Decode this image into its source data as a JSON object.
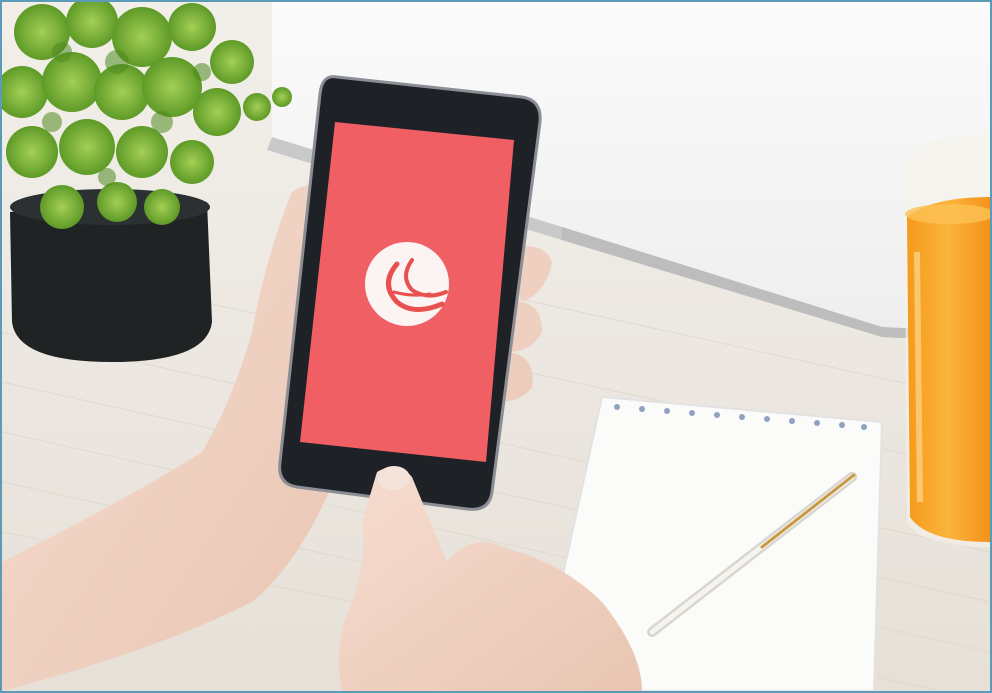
{
  "scene": {
    "phone_screen_color": "#ef5f63",
    "app_logo_color": "#e8514f",
    "juice_color": "#f7a021",
    "plant_leaf_color": "#7fb53a",
    "pot_color": "#1f2324",
    "table_color": "#e9e4dd"
  },
  "elements": {
    "phone_app_icon": "app-logo-icon",
    "plant": "potted-plant",
    "glass": "orange-juice-glass",
    "notepad": "spiral-notepad",
    "pen": "pen"
  }
}
